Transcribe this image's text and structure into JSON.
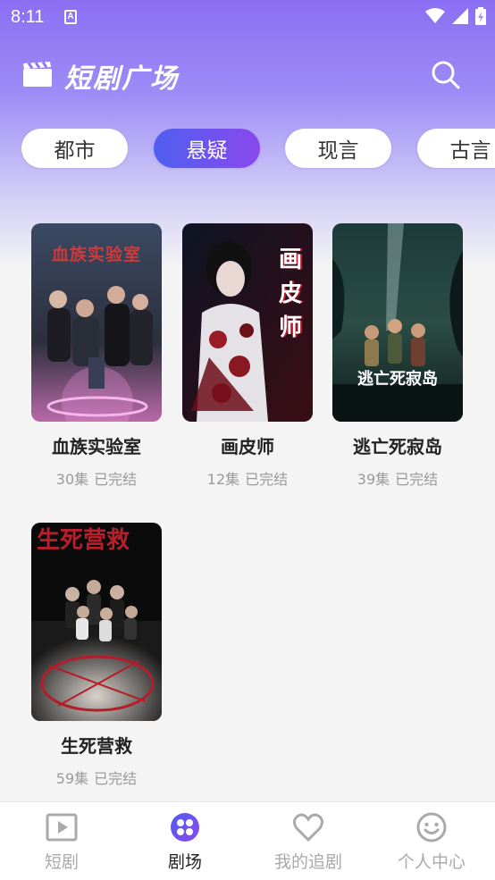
{
  "status_bar": {
    "time": "8:11",
    "notification_badge": "A"
  },
  "header": {
    "title": "短剧广场"
  },
  "categories": [
    {
      "label": "都市",
      "active": false
    },
    {
      "label": "悬疑",
      "active": true
    },
    {
      "label": "现言",
      "active": false
    },
    {
      "label": "古言",
      "active": false
    }
  ],
  "dramas": [
    {
      "title": "血族实验室",
      "episodes": "30集",
      "status": "已完结",
      "poster_text": "血族实验室"
    },
    {
      "title": "画皮师",
      "episodes": "12集",
      "status": "已完结",
      "poster_text": "画皮师"
    },
    {
      "title": "逃亡死寂岛",
      "episodes": "39集",
      "status": "已完结",
      "poster_text": "逃亡死寂岛"
    },
    {
      "title": "生死营救",
      "episodes": "59集",
      "status": "已完结",
      "poster_text": "生死营救"
    }
  ],
  "bottom_nav": [
    {
      "label": "短剧",
      "icon": "play-icon",
      "active": false
    },
    {
      "label": "剧场",
      "icon": "theater-icon",
      "active": true
    },
    {
      "label": "我的追剧",
      "icon": "heart-icon",
      "active": false
    },
    {
      "label": "个人中心",
      "icon": "smile-icon",
      "active": false
    }
  ],
  "colors": {
    "accent_start": "#4f5ff0",
    "accent_end": "#8a48ee",
    "header_gradient": "#8a6ff3"
  }
}
